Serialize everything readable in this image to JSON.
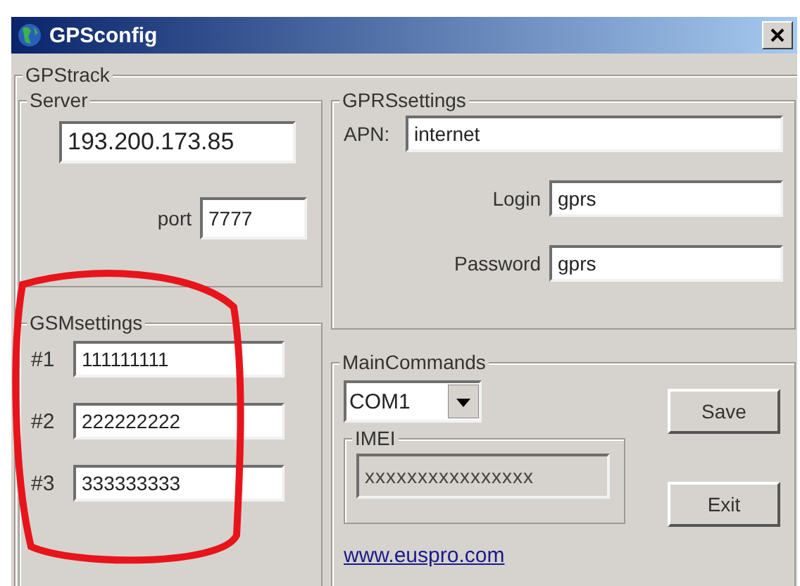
{
  "window": {
    "title": "GPSconfig"
  },
  "gps_track": {
    "label": "GPStrack",
    "server": {
      "label": "Server",
      "address": "193.200.173.85",
      "port_label": "port",
      "port": "7777"
    },
    "gsm_settings": {
      "label": "GSMsettings",
      "numbers": [
        {
          "label": "#1",
          "value": "111111111"
        },
        {
          "label": "#2",
          "value": "222222222"
        },
        {
          "label": "#3",
          "value": "333333333"
        }
      ]
    },
    "gprs_settings": {
      "label": "GPRSsettings",
      "fields": [
        {
          "kind": "wide",
          "label": "APN:",
          "value": "internet"
        },
        {
          "kind": "indented",
          "label": "Login",
          "value": "gprs"
        },
        {
          "kind": "indented",
          "label": "Password",
          "value": "gprs"
        }
      ]
    },
    "main_commands": {
      "label": "MainCommands",
      "port": "COM1",
      "imei": {
        "label": "IMEI",
        "value": "xxxxxxxxxxxxxxxx"
      },
      "buttons": [
        "Save",
        "Exit"
      ],
      "link": "www.euspro.com"
    }
  }
}
